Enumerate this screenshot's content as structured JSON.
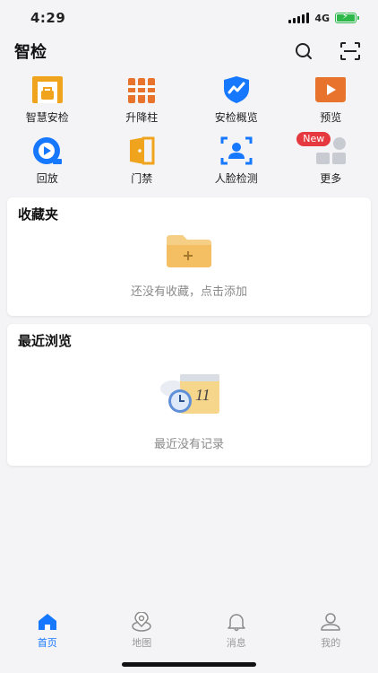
{
  "status_bar": {
    "time": "4:29",
    "network": "4G",
    "battery_color": "#2eb84a"
  },
  "header": {
    "title": "智检",
    "search_icon": "search-icon",
    "scan_icon": "scan-icon"
  },
  "grid": {
    "items": [
      {
        "label": "智慧安检",
        "icon": "security-gate-icon"
      },
      {
        "label": "升降柱",
        "icon": "bollard-icon"
      },
      {
        "label": "安检概览",
        "icon": "shield-chart-icon"
      },
      {
        "label": "预览",
        "icon": "video-play-icon"
      },
      {
        "label": "回放",
        "icon": "playback-icon"
      },
      {
        "label": "门禁",
        "icon": "door-icon"
      },
      {
        "label": "人脸检测",
        "icon": "face-scan-icon"
      },
      {
        "label": "更多",
        "icon": "more-apps-icon",
        "badge": "New"
      }
    ]
  },
  "favorites": {
    "title": "收藏夹",
    "empty_text": "还没有收藏，点击添加"
  },
  "recent": {
    "title": "最近浏览",
    "empty_text": "最近没有记录"
  },
  "tabbar": {
    "items": [
      {
        "label": "首页",
        "icon": "home-icon",
        "active": true
      },
      {
        "label": "地图",
        "icon": "map-pin-icon",
        "active": false
      },
      {
        "label": "消息",
        "icon": "bell-icon",
        "active": false
      },
      {
        "label": "我的",
        "icon": "profile-icon",
        "active": false
      }
    ]
  },
  "colors": {
    "accent": "#1677ff",
    "orange": "#e8732c",
    "gold": "#f0a31c",
    "badge": "#e5393f"
  }
}
